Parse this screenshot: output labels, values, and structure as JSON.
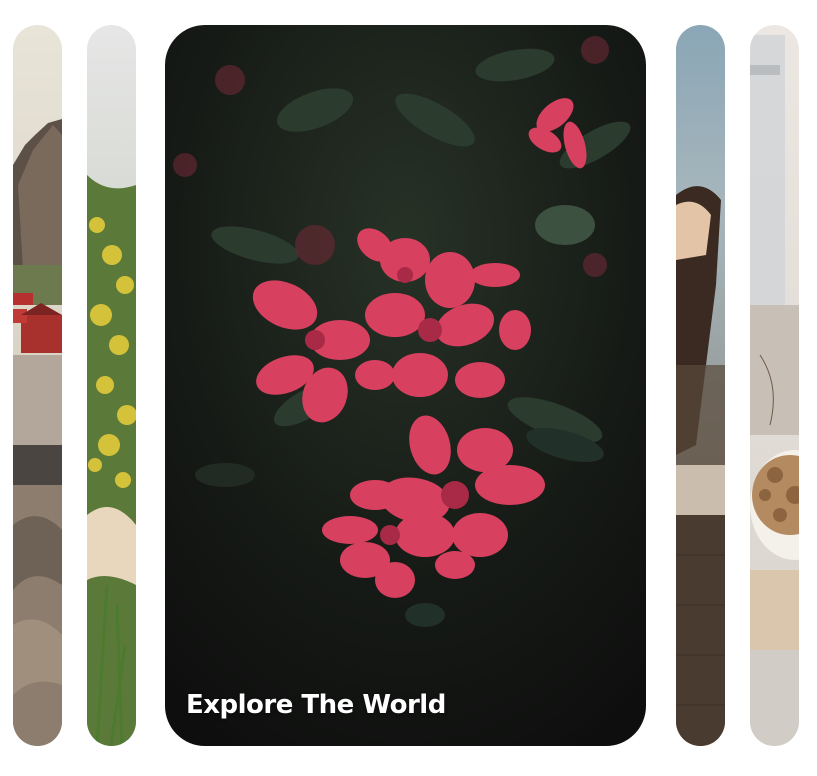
{
  "carousel": {
    "panels": [
      {
        "id": "mountain-village",
        "icon": "photo-mountain-village",
        "active": false
      },
      {
        "id": "yellow-flowers",
        "icon": "photo-yellow-flowers",
        "active": false
      },
      {
        "id": "red-azalea",
        "icon": "photo-red-azalea",
        "active": true,
        "caption": "Explore The World"
      },
      {
        "id": "woman-window",
        "icon": "photo-woman-window",
        "active": false
      },
      {
        "id": "pastry-table",
        "icon": "photo-pastry-table",
        "active": false
      }
    ]
  },
  "colors": {
    "background": "#ffffff",
    "caption": "#ffffff",
    "flower": "#d8405f",
    "leaf": "#2a3a2c"
  }
}
